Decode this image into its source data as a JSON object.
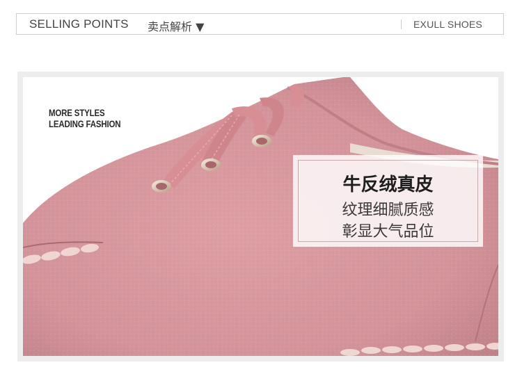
{
  "header": {
    "title": "SELLING POINTS",
    "subtitle": "卖点解析 ▼",
    "brand": "EXULL SHOES"
  },
  "photo": {
    "slogan_line1": "MORE STYLES",
    "slogan_line2": "LEADING FASHION",
    "feature": {
      "title": "牛反绒真皮",
      "line1": "纹理细腻质感",
      "line2": "彰显大气品位"
    }
  },
  "colors": {
    "suede_pink": "#d99aa0",
    "suede_shadow": "#b97a80",
    "lace_pink": "#d88e95",
    "frame_gray": "#ededed"
  }
}
